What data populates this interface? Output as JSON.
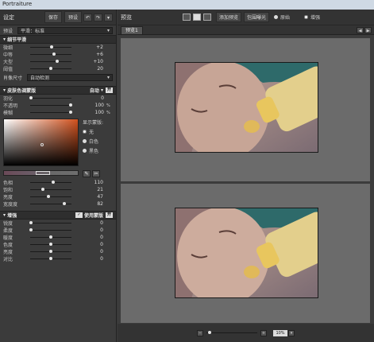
{
  "app": {
    "title": "Portraiture"
  },
  "left": {
    "title": "设定",
    "save": "保存",
    "preset_btn": "预设",
    "preset": {
      "label": "预设",
      "value": "平滑：标准"
    },
    "detail": {
      "title": "细节平滑",
      "rows": [
        {
          "label": "微细",
          "value": "+2",
          "pos": 0.52
        },
        {
          "label": "中等",
          "value": "+6",
          "pos": 0.58
        },
        {
          "label": "大型",
          "value": "+10",
          "pos": 0.66
        },
        {
          "label": "阈值",
          "value": "20",
          "pos": 0.5
        }
      ],
      "size_label": "肖像尺寸",
      "size_value": "自动检测"
    },
    "skin": {
      "title": "皮肤色调蒙版",
      "mode": "自动",
      "toggle": "开",
      "rows": [
        {
          "label": "羽化",
          "value": "0",
          "pct": "",
          "pos": 0.02
        },
        {
          "label": "不透明",
          "value": "100",
          "pct": "%",
          "pos": 0.98
        },
        {
          "label": "模糊",
          "value": "100",
          "pct": "%",
          "pos": 0.98
        }
      ],
      "mask_title": "显示蒙版:",
      "mask_opts": [
        "无",
        "白色",
        "黑色"
      ],
      "color_rows": [
        {
          "label": "色相",
          "value": "110",
          "pos": 0.55
        },
        {
          "label": "饱和",
          "value": "21",
          "pos": 0.3
        },
        {
          "label": "亮度",
          "value": "47",
          "pos": 0.45
        },
        {
          "label": "宽度度",
          "value": "82",
          "pos": 0.82
        }
      ]
    },
    "enhance": {
      "title": "增强",
      "mask_label": "使用蒙版",
      "toggle": "开",
      "rows": [
        {
          "label": "锐度",
          "value": "0",
          "pos": 0.02
        },
        {
          "label": "柔度",
          "value": "0",
          "pos": 0.02
        },
        {
          "label": "暖度",
          "value": "0",
          "pos": 0.5
        },
        {
          "label": "色度",
          "value": "0",
          "pos": 0.5
        },
        {
          "label": "亮度",
          "value": "0",
          "pos": 0.5
        },
        {
          "label": "对比",
          "value": "0",
          "pos": 0.5
        }
      ]
    }
  },
  "right": {
    "title": "预览",
    "add_preview": "添加预览",
    "dual_exposure": "包围曝光",
    "original": "原始",
    "enhanced": "增强",
    "tab": "预览1",
    "zoom": "10%"
  },
  "colors": {
    "picker": "#d2521e"
  }
}
